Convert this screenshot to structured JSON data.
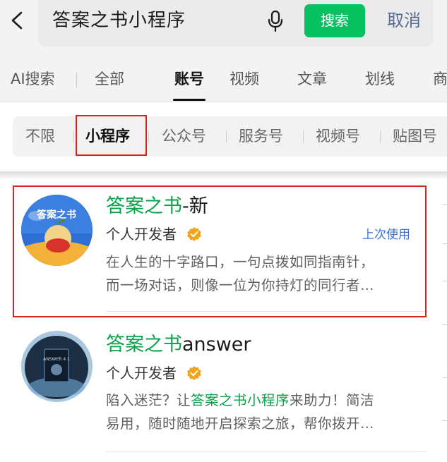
{
  "search": {
    "back_icon": "chevron-left-icon",
    "query": "答案之书小程序",
    "mic_icon": "microphone-icon",
    "search_button": "搜索",
    "cancel": "取消"
  },
  "tabs": [
    {
      "label": "AI搜索"
    },
    {
      "label": "全部"
    },
    {
      "label": "账号",
      "active": true
    },
    {
      "label": "视频"
    },
    {
      "label": "文章"
    },
    {
      "label": "划线"
    },
    {
      "label": "商"
    }
  ],
  "filters": [
    {
      "label": "不限"
    },
    {
      "label": "小程序",
      "active": true
    },
    {
      "label": "公众号"
    },
    {
      "label": "服务号"
    },
    {
      "label": "视频号"
    },
    {
      "label": "贴图号"
    }
  ],
  "results": [
    {
      "title_highlight": "答案之书",
      "title_rest": "-新",
      "developer": "个人开发者",
      "badge_icon": "verified-badge-icon",
      "tag": "上次使用",
      "desc_line1": "在人生的十字路口，一句点拨如同指南针，",
      "desc_line2": "而一场对话，则像一位为你持灯的同行者…",
      "avatar_text": "答案之书"
    },
    {
      "title_highlight": "答案之书",
      "title_rest": "answer",
      "developer": "个人开发者",
      "badge_icon": "verified-badge-icon",
      "desc_pre": "陷入迷茫？让",
      "desc_highlight": "答案之书小程序",
      "desc_post": "来助力！简洁",
      "desc_line2": "易用，随时随地开启探索之旅，帮你拨开…",
      "avatar_text": "ANSWER 4 1"
    }
  ],
  "colors": {
    "accent_green": "#07c160",
    "highlight_green": "#07a148",
    "link_blue": "#576b95",
    "tag_blue": "#3b72d8",
    "annotation_red": "#d9241c"
  }
}
